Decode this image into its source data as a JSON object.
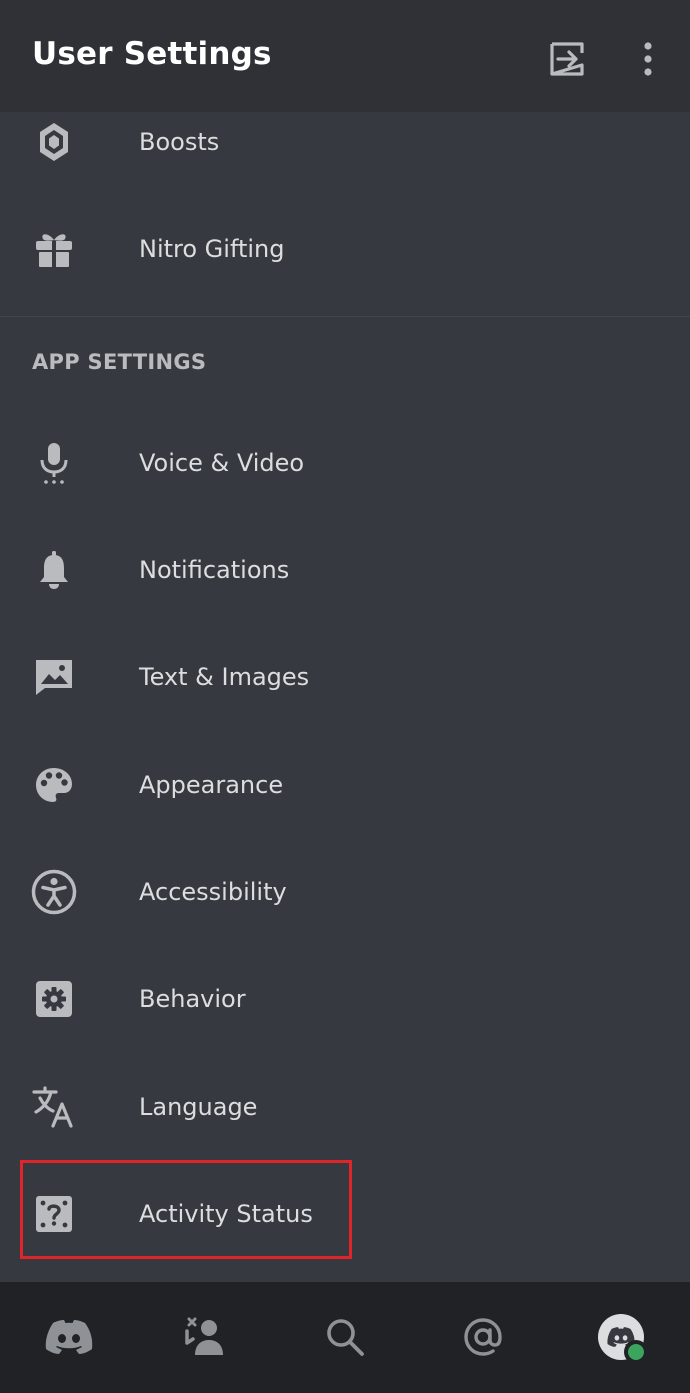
{
  "header": {
    "title": "User Settings"
  },
  "account_items": [
    {
      "label": "Boosts",
      "icon": "boost-icon"
    },
    {
      "label": "Nitro Gifting",
      "icon": "gift-icon"
    }
  ],
  "app_settings": {
    "section_title": "APP SETTINGS",
    "items": [
      {
        "label": "Voice & Video",
        "icon": "microphone-icon"
      },
      {
        "label": "Notifications",
        "icon": "bell-icon"
      },
      {
        "label": "Text & Images",
        "icon": "image-icon"
      },
      {
        "label": "Appearance",
        "icon": "palette-icon"
      },
      {
        "label": "Accessibility",
        "icon": "accessibility-icon"
      },
      {
        "label": "Behavior",
        "icon": "gear-icon"
      },
      {
        "label": "Language",
        "icon": "translate-icon"
      },
      {
        "label": "Activity Status",
        "icon": "activity-status-icon"
      }
    ]
  },
  "highlighted_item": "Activity Status",
  "colors": {
    "background": "#36393f",
    "header": "#2f3136",
    "tabbar": "#202225",
    "highlight_border": "#e0242b",
    "online": "#3ba55d"
  },
  "tabbar": {
    "tabs": [
      "home-tab",
      "friends-tab",
      "search-tab",
      "mentions-tab",
      "profile-tab"
    ]
  }
}
